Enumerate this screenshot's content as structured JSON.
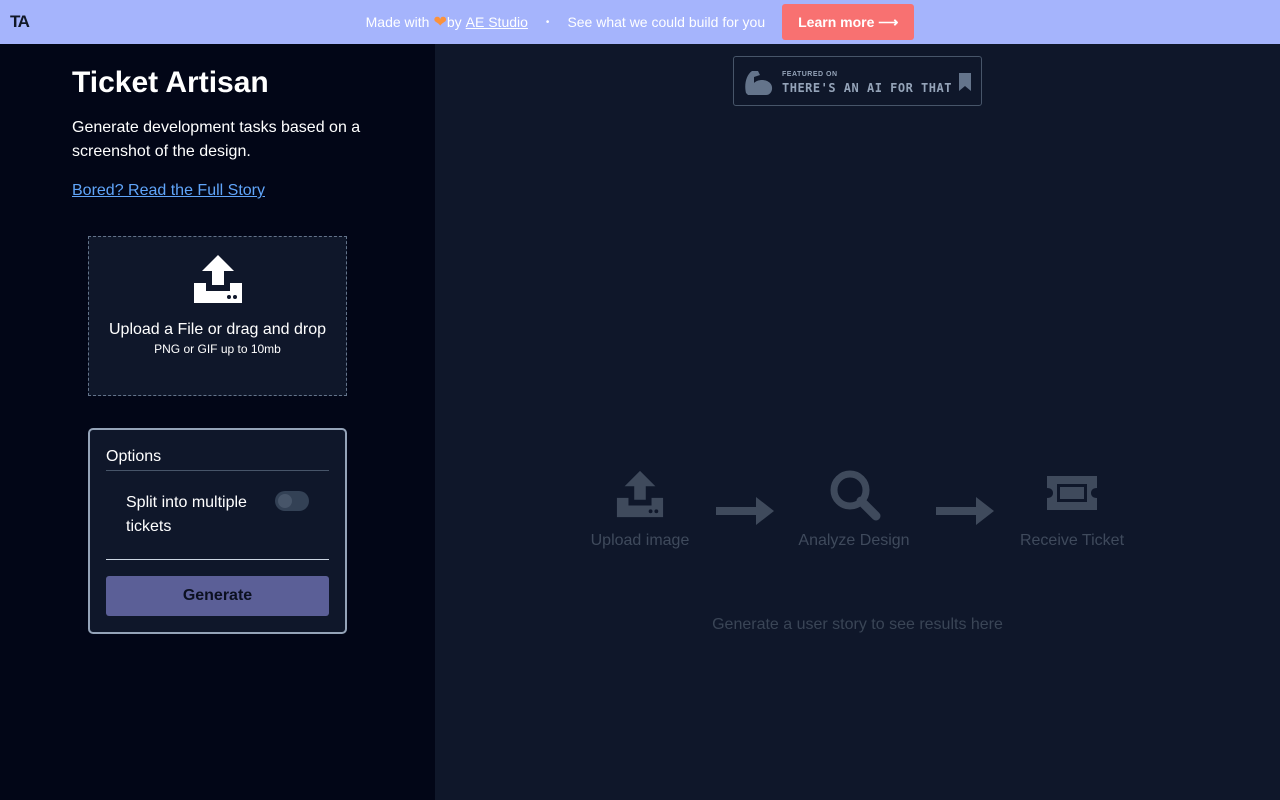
{
  "banner": {
    "logo": "TA",
    "made_with": "Made with",
    "by": "by",
    "studio_link": "AE Studio",
    "separator": "•",
    "tagline": "See what we could build for you",
    "learn_more": "Learn more ⟶"
  },
  "sidebar": {
    "title": "Ticket Artisan",
    "subtitle": "Generate development tasks based on a screenshot of the design.",
    "story_link": "Bored? Read the Full Story",
    "upload": {
      "text": "Upload a File or drag and drop",
      "hint": "PNG or GIF up to 10mb"
    },
    "options": {
      "legend": "Options",
      "split_label": "Split into multiple tickets",
      "split_enabled": false,
      "generate_label": "Generate"
    }
  },
  "main": {
    "badge": {
      "small": "FEATURED ON",
      "big": "THERE'S AN AI FOR THAT"
    },
    "steps": [
      {
        "label": "Upload image",
        "icon": "upload-icon"
      },
      {
        "label": "Analyze Design",
        "icon": "magnifier-icon"
      },
      {
        "label": "Receive Ticket",
        "icon": "ticket-icon"
      }
    ],
    "empty_message": "Generate a user story to see results here"
  },
  "colors": {
    "banner_bg": "#a5b4fc",
    "learn_btn": "#f87171",
    "sidebar_bg": "#020617",
    "main_bg": "#0f172a",
    "link": "#60a5fa",
    "generate_btn": "#5b5f97"
  }
}
